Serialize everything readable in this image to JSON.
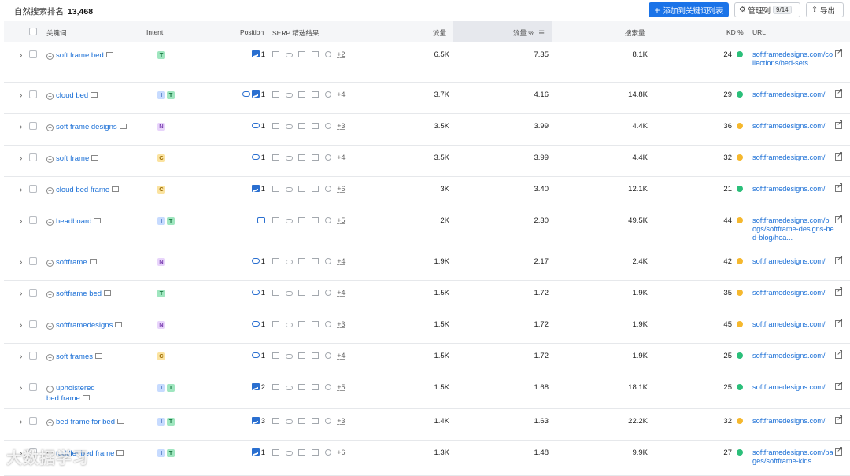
{
  "toolbar": {
    "rank_label": "自然搜索排名:",
    "rank_value": "13,468",
    "add_button": "添加到关键词列表",
    "manage_button": "管理列",
    "manage_count": "9/14",
    "export_button": "导出"
  },
  "columns": {
    "keyword": "关键词",
    "intent": "Intent",
    "position": "Position",
    "serp": "SERP 精选结果",
    "traffic": "流量",
    "traffic_pct": "流量 %",
    "volume": "搜索量",
    "kd": "KD %",
    "url": "URL"
  },
  "kd_colors": {
    "green": "#2bbf7a",
    "yellow": "#f5b82e"
  },
  "rows": [
    {
      "keyword": "soft frame bed",
      "intents": [
        "T"
      ],
      "pos_icon": "image",
      "position": "1",
      "serp_more": "+2",
      "traffic": "6.5K",
      "traffic_pct": "7.35",
      "volume": "8.1K",
      "kd": "24",
      "kd_color": "green",
      "url": "softframedesigns.com/collections/bed-sets"
    },
    {
      "keyword": "cloud bed",
      "intents": [
        "I",
        "T"
      ],
      "pos_icon": "link-image",
      "position": "1",
      "serp_more": "+4",
      "traffic": "3.7K",
      "traffic_pct": "4.16",
      "volume": "14.8K",
      "kd": "29",
      "kd_color": "green",
      "url": "softframedesigns.com/"
    },
    {
      "keyword": "soft frame designs",
      "intents": [
        "N"
      ],
      "pos_icon": "link",
      "position": "1",
      "serp_more": "+3",
      "traffic": "3.5K",
      "traffic_pct": "3.99",
      "volume": "4.4K",
      "kd": "36",
      "kd_color": "yellow",
      "url": "softframedesigns.com/"
    },
    {
      "keyword": "soft frame",
      "intents": [
        "C"
      ],
      "pos_icon": "link",
      "position": "1",
      "serp_more": "+4",
      "traffic": "3.5K",
      "traffic_pct": "3.99",
      "volume": "4.4K",
      "kd": "32",
      "kd_color": "yellow",
      "url": "softframedesigns.com/"
    },
    {
      "keyword": "cloud bed frame",
      "intents": [
        "C"
      ],
      "pos_icon": "image",
      "position": "1",
      "serp_more": "+6",
      "traffic": "3K",
      "traffic_pct": "3.40",
      "volume": "12.1K",
      "kd": "21",
      "kd_color": "green",
      "url": "softframedesigns.com/"
    },
    {
      "keyword": "headboard",
      "intents": [
        "I",
        "T"
      ],
      "pos_icon": "chat",
      "position": "",
      "serp_more": "+5",
      "traffic": "2K",
      "traffic_pct": "2.30",
      "volume": "49.5K",
      "kd": "44",
      "kd_color": "yellow",
      "url": "softframedesigns.com/blogs/softframe-designs-bed-blog/hea..."
    },
    {
      "keyword": "softframe",
      "intents": [
        "N"
      ],
      "pos_icon": "link",
      "position": "1",
      "serp_more": "+4",
      "traffic": "1.9K",
      "traffic_pct": "2.17",
      "volume": "2.4K",
      "kd": "42",
      "kd_color": "yellow",
      "url": "softframedesigns.com/"
    },
    {
      "keyword": "softframe bed",
      "intents": [
        "T"
      ],
      "pos_icon": "link",
      "position": "1",
      "serp_more": "+4",
      "traffic": "1.5K",
      "traffic_pct": "1.72",
      "volume": "1.9K",
      "kd": "35",
      "kd_color": "yellow",
      "url": "softframedesigns.com/"
    },
    {
      "keyword": "softframedesigns",
      "intents": [
        "N"
      ],
      "pos_icon": "link",
      "position": "1",
      "serp_more": "+3",
      "traffic": "1.5K",
      "traffic_pct": "1.72",
      "volume": "1.9K",
      "kd": "45",
      "kd_color": "yellow",
      "url": "softframedesigns.com/"
    },
    {
      "keyword": "soft frames",
      "intents": [
        "C"
      ],
      "pos_icon": "link",
      "position": "1",
      "serp_more": "+4",
      "traffic": "1.5K",
      "traffic_pct": "1.72",
      "volume": "1.9K",
      "kd": "25",
      "kd_color": "green",
      "url": "softframedesigns.com/"
    },
    {
      "keyword": "upholstered bed frame",
      "intents": [
        "I",
        "T"
      ],
      "pos_icon": "image",
      "position": "2",
      "serp_more": "+5",
      "traffic": "1.5K",
      "traffic_pct": "1.68",
      "volume": "18.1K",
      "kd": "25",
      "kd_color": "green",
      "url": "softframedesigns.com/"
    },
    {
      "keyword": "bed frame for bed",
      "intents": [
        "I",
        "T"
      ],
      "pos_icon": "image",
      "position": "3",
      "serp_more": "+3",
      "traffic": "1.4K",
      "traffic_pct": "1.63",
      "volume": "22.2K",
      "kd": "32",
      "kd_color": "yellow",
      "url": "softframedesigns.com/"
    },
    {
      "keyword": "toddler bed frame",
      "intents": [
        "I",
        "T"
      ],
      "pos_icon": "image",
      "position": "1",
      "serp_more": "+6",
      "traffic": "1.3K",
      "traffic_pct": "1.48",
      "volume": "9.9K",
      "kd": "27",
      "kd_color": "green",
      "url": "softframedesigns.com/pages/softframe-kids"
    }
  ],
  "watermark": "大数据学习"
}
